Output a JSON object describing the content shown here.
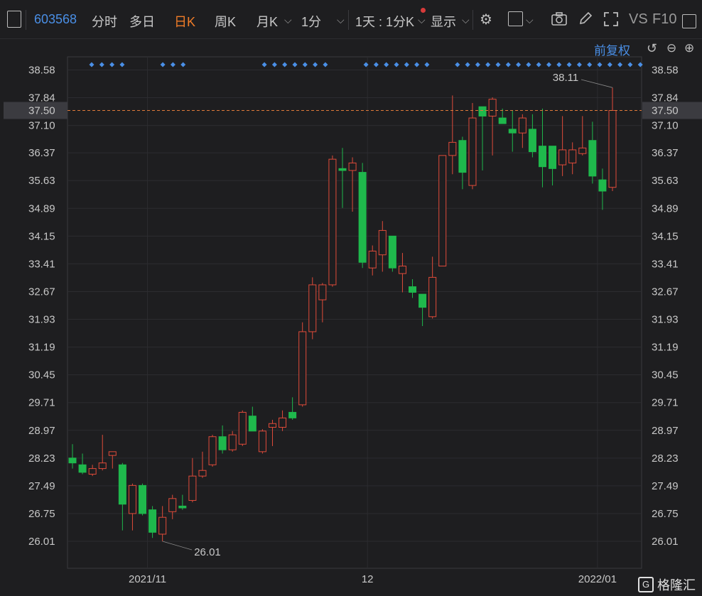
{
  "toolbar": {
    "stock_code": "603568",
    "tabs": [
      "分时",
      "多日",
      "日K",
      "周K",
      "月K",
      "1分"
    ],
    "active_tab": "日K",
    "period_select": "1天 : 1分K",
    "display_label": "显示",
    "vs_label": "VS",
    "f10_label": "F10"
  },
  "adjust_label": "前复权",
  "logo_text": "格隆汇",
  "colors": {
    "up": "#e04b3a",
    "down": "#1fb84c",
    "price_line": "#e07a3a",
    "accent": "#4a8fe6",
    "background": "#1e1e20"
  },
  "chart_data": {
    "type": "candlestick",
    "current_price": "37.50",
    "y_ticks": [
      "38.58",
      "37.84",
      "37.10",
      "36.37",
      "35.63",
      "34.89",
      "34.15",
      "33.41",
      "32.67",
      "31.93",
      "31.19",
      "30.45",
      "29.71",
      "28.97",
      "28.23",
      "27.49",
      "26.75",
      "26.01"
    ],
    "x_labels": [
      "2021/11",
      "12",
      "2022/01"
    ],
    "high_label": "38.11",
    "low_label": "26.01",
    "candles": [
      {
        "o": 28.23,
        "h": 28.6,
        "l": 27.95,
        "c": 28.1
      },
      {
        "o": 28.05,
        "h": 28.35,
        "l": 27.8,
        "c": 27.85
      },
      {
        "o": 27.8,
        "h": 28.05,
        "l": 27.75,
        "c": 27.95
      },
      {
        "o": 27.95,
        "h": 28.85,
        "l": 27.9,
        "c": 28.1
      },
      {
        "o": 28.3,
        "h": 28.4,
        "l": 27.95,
        "c": 28.4
      },
      {
        "o": 28.05,
        "h": 28.1,
        "l": 26.3,
        "c": 27.0
      },
      {
        "o": 26.75,
        "h": 27.55,
        "l": 26.3,
        "c": 27.5
      },
      {
        "o": 27.5,
        "h": 27.55,
        "l": 26.7,
        "c": 26.75
      },
      {
        "o": 26.85,
        "h": 26.95,
        "l": 26.1,
        "c": 26.25
      },
      {
        "o": 26.2,
        "h": 26.95,
        "l": 26.01,
        "c": 26.65
      },
      {
        "o": 26.8,
        "h": 27.25,
        "l": 26.6,
        "c": 27.15
      },
      {
        "o": 26.95,
        "h": 27.25,
        "l": 26.85,
        "c": 26.9
      },
      {
        "o": 27.1,
        "h": 28.23,
        "l": 27.05,
        "c": 27.75
      },
      {
        "o": 27.75,
        "h": 28.4,
        "l": 27.7,
        "c": 27.9
      },
      {
        "o": 28.05,
        "h": 28.85,
        "l": 28.0,
        "c": 28.8
      },
      {
        "o": 28.8,
        "h": 29.1,
        "l": 28.35,
        "c": 28.45
      },
      {
        "o": 28.45,
        "h": 28.95,
        "l": 28.4,
        "c": 28.85
      },
      {
        "o": 28.6,
        "h": 29.5,
        "l": 28.55,
        "c": 29.45
      },
      {
        "o": 29.35,
        "h": 29.6,
        "l": 28.95,
        "c": 28.95
      },
      {
        "o": 28.4,
        "h": 29.0,
        "l": 28.35,
        "c": 28.95
      },
      {
        "o": 29.05,
        "h": 29.25,
        "l": 28.55,
        "c": 29.15
      },
      {
        "o": 29.05,
        "h": 29.5,
        "l": 28.95,
        "c": 29.3
      },
      {
        "o": 29.45,
        "h": 29.85,
        "l": 29.25,
        "c": 29.3
      },
      {
        "o": 29.65,
        "h": 31.85,
        "l": 29.6,
        "c": 31.6
      },
      {
        "o": 31.6,
        "h": 33.05,
        "l": 31.4,
        "c": 32.85
      },
      {
        "o": 32.45,
        "h": 32.9,
        "l": 31.85,
        "c": 32.85
      },
      {
        "o": 32.85,
        "h": 36.3,
        "l": 32.8,
        "c": 36.2
      },
      {
        "o": 35.95,
        "h": 36.5,
        "l": 34.9,
        "c": 35.9
      },
      {
        "o": 35.9,
        "h": 36.25,
        "l": 34.8,
        "c": 36.1
      },
      {
        "o": 35.85,
        "h": 36.1,
        "l": 33.3,
        "c": 33.45
      },
      {
        "o": 33.3,
        "h": 33.9,
        "l": 33.1,
        "c": 33.75
      },
      {
        "o": 33.65,
        "h": 34.55,
        "l": 33.2,
        "c": 34.3
      },
      {
        "o": 34.15,
        "h": 34.15,
        "l": 33.2,
        "c": 33.3
      },
      {
        "o": 33.15,
        "h": 33.7,
        "l": 32.65,
        "c": 33.35
      },
      {
        "o": 32.8,
        "h": 33.0,
        "l": 32.5,
        "c": 32.65
      },
      {
        "o": 32.6,
        "h": 32.6,
        "l": 31.75,
        "c": 32.25
      },
      {
        "o": 32.0,
        "h": 33.6,
        "l": 31.95,
        "c": 33.05
      },
      {
        "o": 33.35,
        "h": 36.3,
        "l": 33.35,
        "c": 36.3
      },
      {
        "o": 36.3,
        "h": 37.9,
        "l": 35.8,
        "c": 36.65
      },
      {
        "o": 36.7,
        "h": 36.8,
        "l": 35.4,
        "c": 35.85
      },
      {
        "o": 35.5,
        "h": 37.7,
        "l": 35.4,
        "c": 37.3
      },
      {
        "o": 37.6,
        "h": 37.6,
        "l": 35.9,
        "c": 37.35
      },
      {
        "o": 37.35,
        "h": 37.85,
        "l": 36.3,
        "c": 37.8
      },
      {
        "o": 37.3,
        "h": 37.55,
        "l": 37.15,
        "c": 37.15
      },
      {
        "o": 37.0,
        "h": 37.5,
        "l": 36.4,
        "c": 36.9
      },
      {
        "o": 36.9,
        "h": 37.4,
        "l": 36.5,
        "c": 37.3
      },
      {
        "o": 37.0,
        "h": 37.4,
        "l": 36.25,
        "c": 36.4
      },
      {
        "o": 36.55,
        "h": 37.55,
        "l": 35.45,
        "c": 36.0
      },
      {
        "o": 36.55,
        "h": 36.55,
        "l": 35.5,
        "c": 35.95
      },
      {
        "o": 36.05,
        "h": 37.35,
        "l": 35.75,
        "c": 36.45
      },
      {
        "o": 36.1,
        "h": 36.65,
        "l": 35.8,
        "c": 36.45
      },
      {
        "o": 36.35,
        "h": 37.35,
        "l": 36.3,
        "c": 36.5
      },
      {
        "o": 36.7,
        "h": 37.2,
        "l": 35.55,
        "c": 35.75
      },
      {
        "o": 35.65,
        "h": 35.95,
        "l": 34.85,
        "c": 35.35
      },
      {
        "o": 35.45,
        "h": 38.11,
        "l": 35.35,
        "c": 37.5
      }
    ],
    "event_marker_groups": [
      4,
      3,
      7,
      7,
      19
    ]
  }
}
